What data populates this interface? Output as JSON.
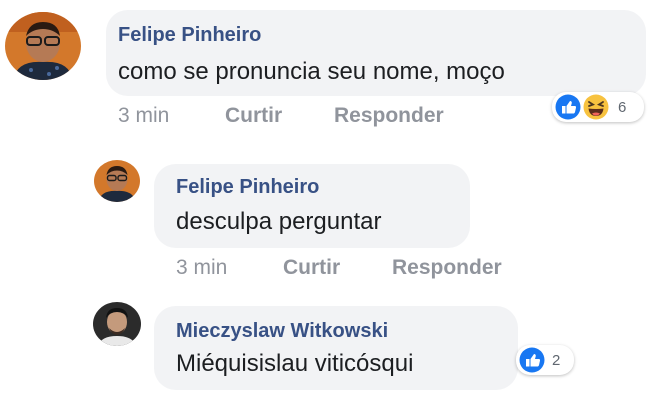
{
  "comments": [
    {
      "author": "Felipe Pinheiro",
      "text": "como se pronuncia seu nome, moço",
      "time": "3 min",
      "like_label": "Curtir",
      "reply_label": "Responder",
      "reactions": {
        "icons": [
          "like-icon",
          "haha-icon"
        ],
        "count": "6"
      }
    },
    {
      "author": "Felipe Pinheiro",
      "text": "desculpa perguntar",
      "time": "3 min",
      "like_label": "Curtir",
      "reply_label": "Responder"
    },
    {
      "author": "Mieczyslaw Witkowski",
      "text": "Miéquisislau viticósqui",
      "reactions": {
        "icons": [
          "like-icon"
        ],
        "count": "2"
      }
    }
  ],
  "colors": {
    "bubble": "#f2f3f5",
    "author": "#385185",
    "text": "#1c1e21",
    "meta": "#90949c",
    "like_blue": "#1877f2",
    "haha_yellow": "#f7c23f"
  }
}
